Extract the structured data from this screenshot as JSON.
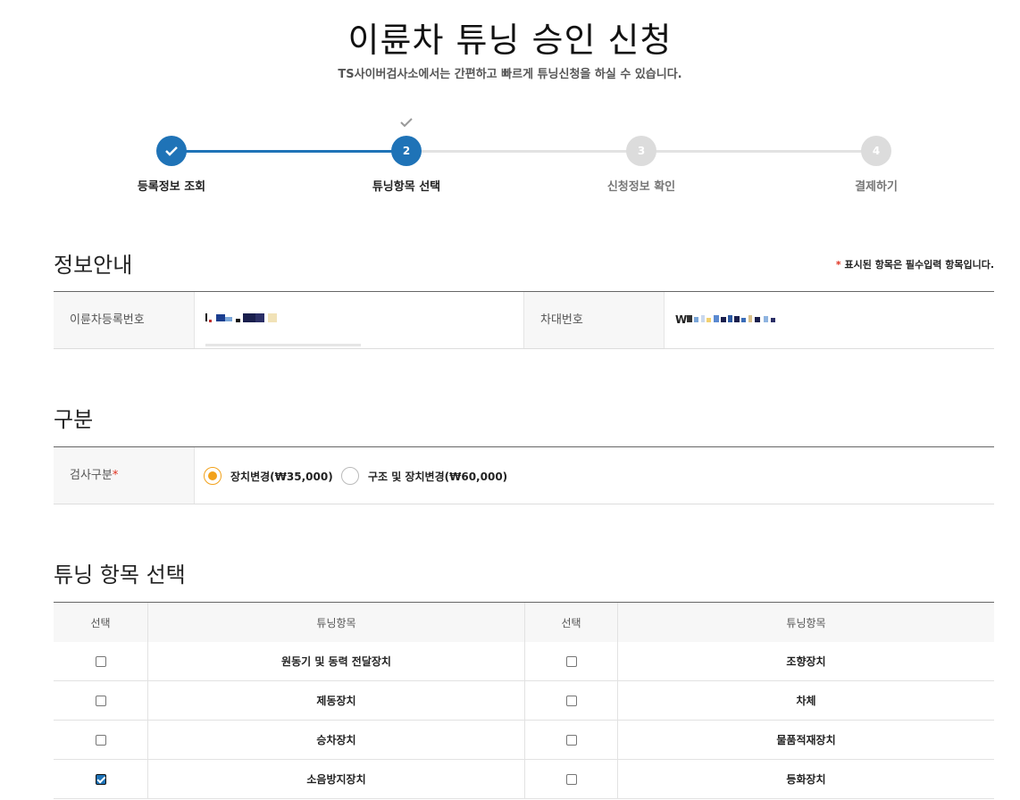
{
  "header": {
    "title": "이륜차 튜닝 승인 신청",
    "subtitle": "TS사이버검사소에서는 간편하고 빠르게 튜닝신청을 하실 수 있습니다."
  },
  "stepper": {
    "steps": [
      {
        "label": "등록정보 조회",
        "number": "1",
        "status": "done"
      },
      {
        "label": "튜닝항목 선택",
        "number": "2",
        "status": "active"
      },
      {
        "label": "신청정보 확인",
        "number": "3",
        "status": "todo"
      },
      {
        "label": "결제하기",
        "number": "4",
        "status": "todo"
      }
    ]
  },
  "info_section": {
    "title": "정보안내",
    "required_note_star": "*",
    "required_note": "표시된 항목은 필수입력 항목입니다.",
    "reg_number_label": "이륜차등록번호",
    "vin_label": "차대번호",
    "vin_prefix": "W"
  },
  "gubun_section": {
    "title": "구분",
    "label": "검사구분",
    "label_star": "*",
    "options": [
      {
        "label": "장치변경(₩35,000)",
        "selected": true
      },
      {
        "label": "구조 및 장치변경(₩60,000)",
        "selected": false
      }
    ]
  },
  "tuning_section": {
    "title": "튜닝 항목 선택",
    "headers": {
      "select": "선택",
      "item": "튜닝항목"
    },
    "rows": [
      {
        "left": "원동기 및 동력 전달장치",
        "left_checked": false,
        "right": "조향장치",
        "right_checked": false
      },
      {
        "left": "제동장치",
        "left_checked": false,
        "right": "차체",
        "right_checked": false
      },
      {
        "left": "승차장치",
        "left_checked": false,
        "right": "물품적재장치",
        "right_checked": false
      },
      {
        "left": "소음방지장치",
        "left_checked": true,
        "right": "등화장치",
        "right_checked": false
      }
    ]
  },
  "colors": {
    "accent": "#1f73b7",
    "radio_on": "#f2a21c",
    "required": "#e0301e"
  }
}
